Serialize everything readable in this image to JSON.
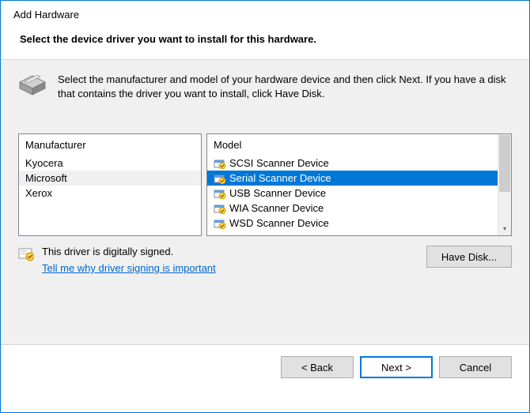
{
  "window": {
    "title": "Add Hardware",
    "subtitle": "Select the device driver you want to install for this hardware."
  },
  "instruction": "Select the manufacturer and model of your hardware device and then click Next. If you have a disk that contains the driver you want to install, click Have Disk.",
  "lists": {
    "manufacturer_header": "Manufacturer",
    "model_header": "Model",
    "manufacturers": [
      {
        "name": "Kyocera",
        "selected": false
      },
      {
        "name": "Microsoft",
        "selected": true
      },
      {
        "name": "Xerox",
        "selected": false
      }
    ],
    "models": [
      {
        "name": "SCSI Scanner Device",
        "selected": false
      },
      {
        "name": "Serial Scanner Device",
        "selected": true
      },
      {
        "name": "USB Scanner Device",
        "selected": false
      },
      {
        "name": "WIA Scanner Device",
        "selected": false
      },
      {
        "name": "WSD Scanner Device",
        "selected": false
      }
    ]
  },
  "signed": {
    "text": "This driver is digitally signed.",
    "link": "Tell me why driver signing is important"
  },
  "buttons": {
    "have_disk": "Have Disk...",
    "back": "< Back",
    "next": "Next >",
    "cancel": "Cancel"
  }
}
